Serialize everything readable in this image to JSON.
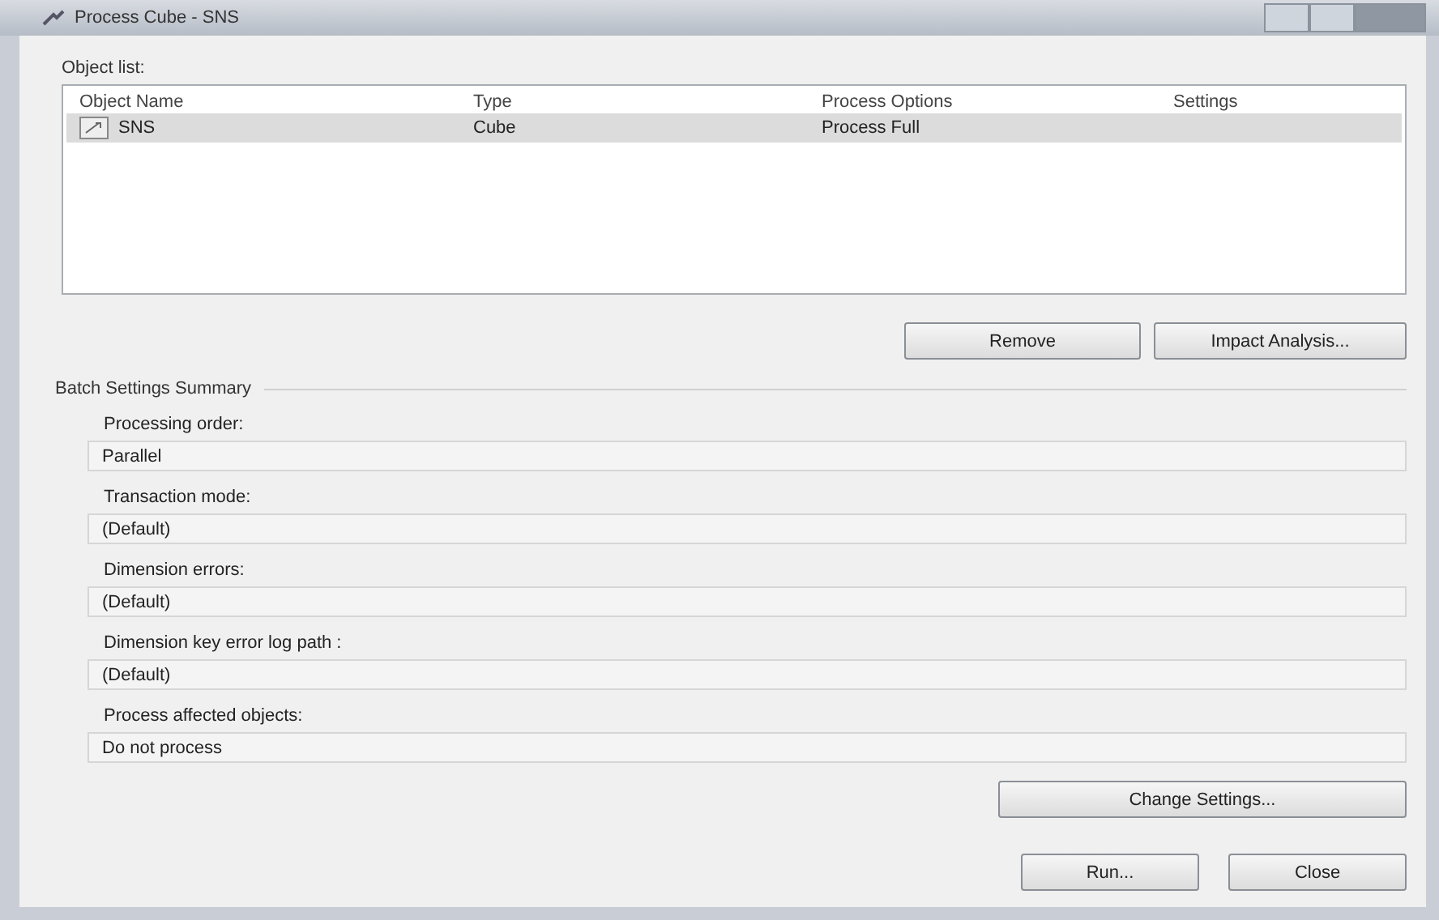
{
  "window": {
    "title": "Process Cube - SNS"
  },
  "object_list": {
    "label": "Object list:",
    "columns": [
      "Object Name",
      "Type",
      "Process Options",
      "Settings"
    ],
    "rows": [
      {
        "cells": [
          "SNS",
          "Cube",
          "Process Full",
          ""
        ],
        "selected": true
      }
    ]
  },
  "list_buttons": [
    "Remove",
    "Impact Analysis..."
  ],
  "batch_settings": {
    "title": "Batch Settings Summary",
    "items": [
      {
        "label": "Processing order:",
        "value": "Parallel"
      },
      {
        "label": "Transaction mode:",
        "value": "(Default)"
      },
      {
        "label": "Dimension errors:",
        "value": "(Default)"
      },
      {
        "label": "Dimension key error log path :",
        "value": "(Default)"
      },
      {
        "label": "Process affected objects:",
        "value": "Do not process"
      }
    ]
  },
  "change_settings_button": "Change Settings...",
  "footer_buttons": [
    "Run...",
    "Close"
  ]
}
